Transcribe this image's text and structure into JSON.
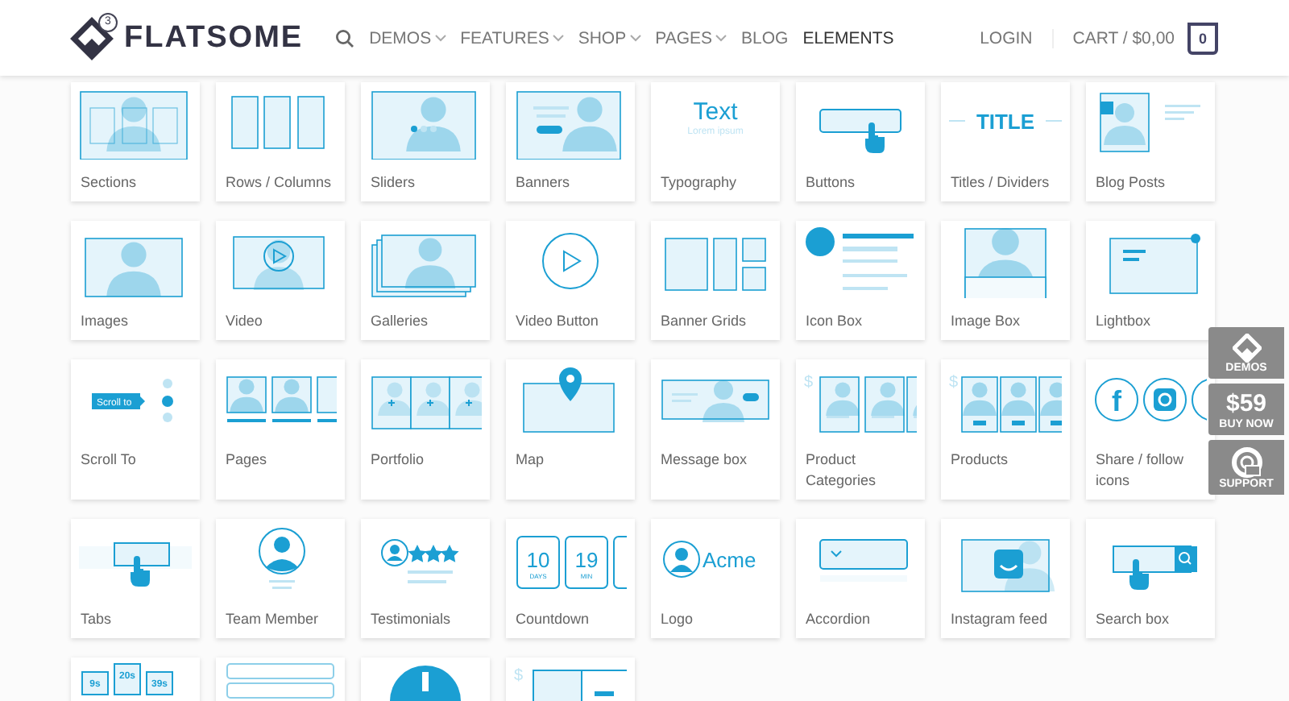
{
  "header": {
    "logo": {
      "badge": "3",
      "name": "FLATSOME"
    },
    "nav": [
      {
        "label": "DEMOS",
        "dropdown": true,
        "selected": false
      },
      {
        "label": "FEATURES",
        "dropdown": true,
        "selected": false
      },
      {
        "label": "SHOP",
        "dropdown": true,
        "selected": false
      },
      {
        "label": "PAGES",
        "dropdown": true,
        "selected": false
      },
      {
        "label": "BLOG",
        "dropdown": false,
        "selected": false
      },
      {
        "label": "ELEMENTS",
        "dropdown": false,
        "selected": true
      }
    ],
    "login": "LOGIN",
    "cart": "CART / $0,00",
    "cart_count": "0"
  },
  "elements": [
    {
      "label": "Sections",
      "kind": "sections"
    },
    {
      "label": "Rows / Columns",
      "kind": "columns"
    },
    {
      "label": "Sliders",
      "kind": "slider"
    },
    {
      "label": "Banners",
      "kind": "banner"
    },
    {
      "label": "Typography",
      "kind": "typography",
      "texts": [
        "Text",
        "Lorem ipsum"
      ]
    },
    {
      "label": "Buttons",
      "kind": "button"
    },
    {
      "label": "Titles / Dividers",
      "kind": "title",
      "texts": [
        "TITLE"
      ]
    },
    {
      "label": "Blog Posts",
      "kind": "blog"
    },
    {
      "label": "Images",
      "kind": "image"
    },
    {
      "label": "Video",
      "kind": "video"
    },
    {
      "label": "Galleries",
      "kind": "gallery"
    },
    {
      "label": "Video Button",
      "kind": "videobutton"
    },
    {
      "label": "Banner Grids",
      "kind": "bannergrid"
    },
    {
      "label": "Icon Box",
      "kind": "iconbox"
    },
    {
      "label": "Image Box",
      "kind": "imagebox"
    },
    {
      "label": "Lightbox",
      "kind": "lightbox"
    },
    {
      "label": "Scroll To",
      "kind": "scrollto",
      "texts": [
        "Scroll to"
      ]
    },
    {
      "label": "Pages",
      "kind": "pages"
    },
    {
      "label": "Portfolio",
      "kind": "portfolio"
    },
    {
      "label": "Map",
      "kind": "map"
    },
    {
      "label": "Message box",
      "kind": "message"
    },
    {
      "label": "Product Categories",
      "kind": "productcats",
      "texts": [
        "$"
      ]
    },
    {
      "label": "Products",
      "kind": "products",
      "texts": [
        "$"
      ]
    },
    {
      "label": "Share / follow icons",
      "kind": "share",
      "texts": [
        "f"
      ]
    },
    {
      "label": "Tabs",
      "kind": "tabs"
    },
    {
      "label": "Team Member",
      "kind": "team"
    },
    {
      "label": "Testimonials",
      "kind": "testimonials"
    },
    {
      "label": "Countdown",
      "kind": "countdown",
      "texts": [
        "10",
        "DAYS",
        "19",
        "MIN"
      ]
    },
    {
      "label": "Logo",
      "kind": "logo",
      "texts": [
        "Acme"
      ]
    },
    {
      "label": "Accordion",
      "kind": "accordion"
    },
    {
      "label": "Instagram feed",
      "kind": "instagram"
    },
    {
      "label": "Search box",
      "kind": "search"
    },
    {
      "kind": "timer",
      "texts": [
        "9s",
        "20s",
        "39s"
      ]
    },
    {
      "kind": "form"
    },
    {
      "kind": "circle"
    },
    {
      "kind": "price",
      "texts": [
        "$"
      ]
    }
  ],
  "side_panel": [
    {
      "kind": "demos",
      "label": "DEMOS"
    },
    {
      "kind": "price",
      "price": "$59",
      "label": "BUY NOW"
    },
    {
      "kind": "support",
      "label": "SUPPORT"
    }
  ]
}
